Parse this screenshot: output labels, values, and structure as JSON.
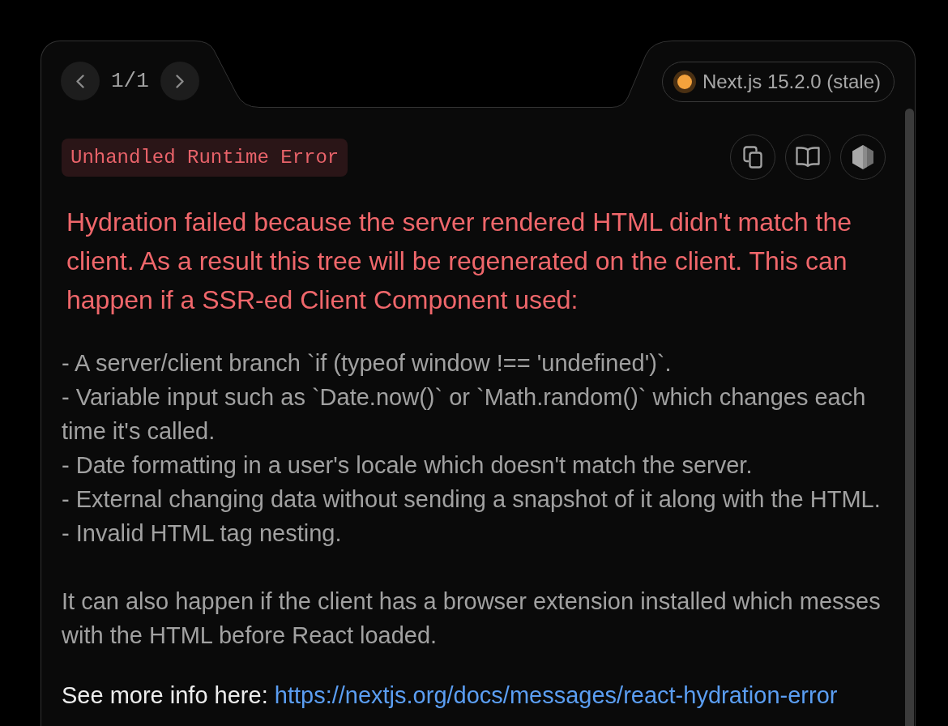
{
  "pager": {
    "label": "1/1"
  },
  "version": {
    "label": "Next.js 15.2.0 (stale)"
  },
  "error_type": "Unhandled Runtime Error",
  "title": "Hydration failed because the server rendered HTML didn't match the client. As a result this tree will be regenerated on the client. This can happen if a SSR-ed Client Component used:",
  "causes": [
    "- A server/client branch `if (typeof window !== 'undefined')`.",
    "- Variable input such as `Date.now()` or `Math.random()` which changes each time it's called.",
    "- Date formatting in a user's locale which doesn't match the server.",
    "- External changing data without sending a snapshot of it along with the HTML.",
    "- Invalid HTML tag nesting."
  ],
  "note": "It can also happen if the client has a browser extension installed which messes with the HTML before React loaded.",
  "more_info": {
    "label": "See more info here:",
    "link": "https://nextjs.org/docs/messages/react-hydration-error"
  }
}
